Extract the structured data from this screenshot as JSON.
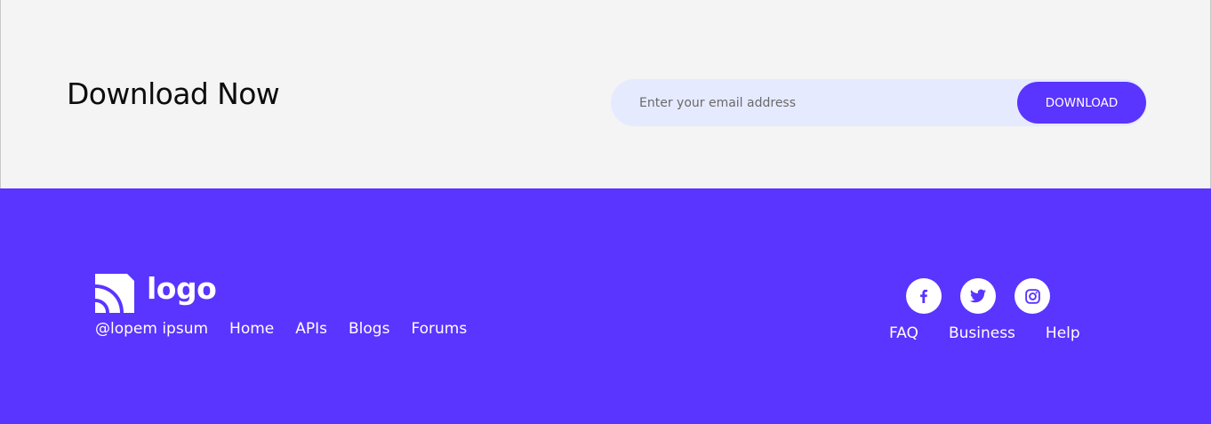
{
  "cta": {
    "title": "Download Now",
    "email_placeholder": "Enter your email address",
    "download_label": "DOWNLOAD"
  },
  "footer": {
    "logo_text": "logo",
    "copyright": "@lopem ipsum",
    "nav": [
      "Home",
      "APIs",
      "Blogs",
      "Forums"
    ],
    "social_icons": [
      "facebook-icon",
      "twitter-icon",
      "instagram-icon"
    ],
    "links": [
      "FAQ",
      "Business",
      "Help"
    ]
  },
  "colors": {
    "accent": "#5a34ff",
    "cta_background": "#f4f4f4",
    "input_background": "#e6eaff",
    "text_dark": "#0d0d0d",
    "text_light": "#ffffff"
  }
}
